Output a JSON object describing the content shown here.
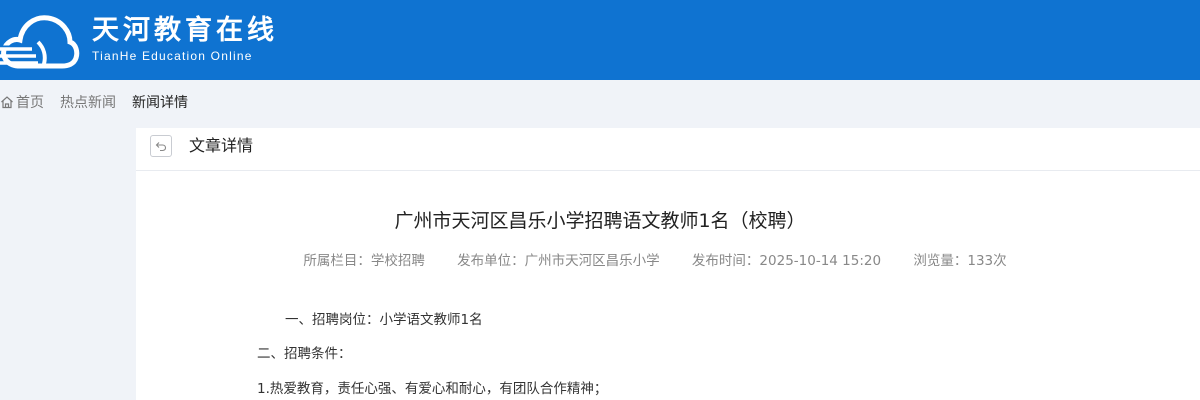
{
  "header": {
    "title": "天河教育在线",
    "subtitle": "TianHe Education Online",
    "brand_color": "#0f73d1"
  },
  "breadcrumb": {
    "home": "首页",
    "section": "热点新闻",
    "current": "新闻详情"
  },
  "panel": {
    "title": "文章详情",
    "back_icon": "back-arrow-icon"
  },
  "article": {
    "title": "广州市天河区昌乐小学招聘语文教师1名（校聘）",
    "meta": {
      "column": "所属栏目：学校招聘",
      "publisher": "发布单位：广州市天河区昌乐小学",
      "time": "发布时间：2025-10-14 15:20",
      "views": "浏览量：133次"
    },
    "body": [
      "一、招聘岗位：小学语文教师1名",
      "二、招聘条件：",
      "1.热爱教育，责任心强、有爱心和耐心，有团队合作精神；"
    ]
  }
}
